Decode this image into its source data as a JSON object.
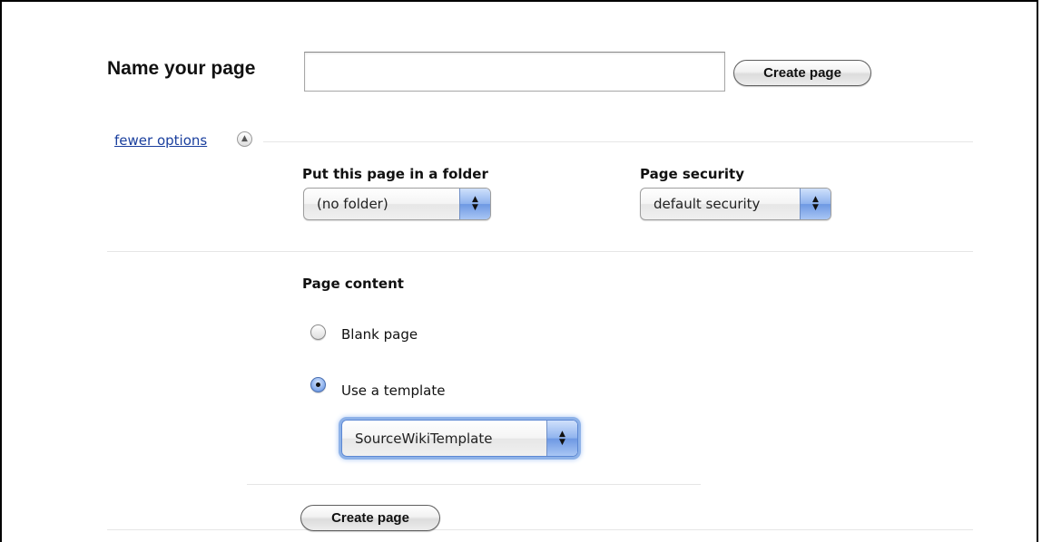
{
  "header": {
    "name_label": "Name your page",
    "name_input_value": "",
    "name_input_placeholder": "",
    "create_button_label": "Create page"
  },
  "options_toggle": {
    "label": "fewer options",
    "icon": "chevron-up-circle-icon"
  },
  "folder": {
    "label": "Put this page in a folder",
    "selected": "(no folder)"
  },
  "security": {
    "label": "Page security",
    "selected": "default security"
  },
  "content": {
    "label": "Page content",
    "options": [
      {
        "label": "Blank page",
        "checked": false
      },
      {
        "label": "Use a template",
        "checked": true
      }
    ],
    "template_selected": "SourceWikiTemplate"
  },
  "footer": {
    "create_button_label": "Create page"
  },
  "colors": {
    "link": "#1a3f9e",
    "select_accent": "#8fb3ee",
    "divider": "#e6e6e6"
  }
}
